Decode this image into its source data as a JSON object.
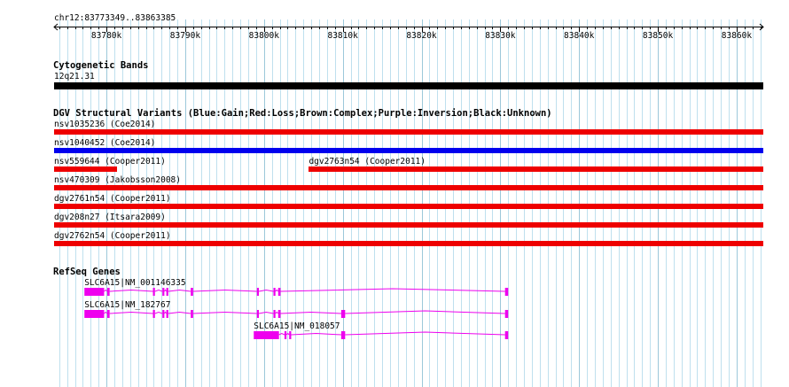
{
  "location": {
    "label": "chr12:83773349..83863385",
    "start": 83773349,
    "end": 83863385
  },
  "ruler": {
    "ticks": [
      {
        "pos": 83780000,
        "label": "83780k"
      },
      {
        "pos": 83790000,
        "label": "83790k"
      },
      {
        "pos": 83800000,
        "label": "83800k"
      },
      {
        "pos": 83810000,
        "label": "83810k"
      },
      {
        "pos": 83820000,
        "label": "83820k"
      },
      {
        "pos": 83830000,
        "label": "83830k"
      },
      {
        "pos": 83840000,
        "label": "83840k"
      },
      {
        "pos": 83850000,
        "label": "83850k"
      },
      {
        "pos": 83860000,
        "label": "83860k"
      }
    ],
    "minor_step": 1000
  },
  "colors": {
    "grid_minor": "#bfe0ee",
    "grid_major": "#9cc8da",
    "gain": "#0000ee",
    "loss": "#ee0000",
    "cytoband": "#000000",
    "gene": "#ee00ee"
  },
  "tracks": {
    "cytoband": {
      "title": "Cytogenetic Bands",
      "band": {
        "name": "12q21.31",
        "start": 83773349,
        "end": 83863385
      }
    },
    "dgv": {
      "title": "DGV Structural Variants (Blue:Gain;Red:Loss;Brown:Complex;Purple:Inversion;Black:Unknown)",
      "variants": [
        {
          "label": "nsv1035236 (Coe2014)",
          "type": "loss",
          "start": 83773349,
          "end": 83863385
        },
        {
          "label": "nsv1040452 (Coe2014)",
          "type": "gain",
          "start": 83773349,
          "end": 83863385
        },
        {
          "label": "nsv559644 (Cooper2011)",
          "type": "loss",
          "start": 83773349,
          "end": 83781300
        },
        {
          "label": "dgv2763n54 (Cooper2011)",
          "type": "loss",
          "start": 83805700,
          "end": 83863385
        },
        {
          "label": "nsv470309 (Jakobsson2008)",
          "type": "loss",
          "start": 83773349,
          "end": 83863385
        },
        {
          "label": "dgv2761n54 (Cooper2011)",
          "type": "loss",
          "start": 83773349,
          "end": 83863385
        },
        {
          "label": "dgv208n27 (Itsara2009)",
          "type": "loss",
          "start": 83773349,
          "end": 83863385
        },
        {
          "label": "dgv2762n54 (Cooper2011)",
          "type": "loss",
          "start": 83773349,
          "end": 83863385
        }
      ]
    },
    "refseq": {
      "title": "RefSeq Genes",
      "transcripts": [
        {
          "label": "SLC6A15|NM_001146335",
          "start": 83777200,
          "end": 83831000,
          "exons": [
            {
              "start": 83777200,
              "end": 83779700
            },
            {
              "start": 83780100,
              "end": 83780400
            },
            {
              "start": 83785900,
              "end": 83786150
            },
            {
              "start": 83787100,
              "end": 83787350
            },
            {
              "start": 83787600,
              "end": 83787850
            },
            {
              "start": 83790700,
              "end": 83791000
            },
            {
              "start": 83799100,
              "end": 83799350
            },
            {
              "start": 83801200,
              "end": 83801450
            },
            {
              "start": 83801800,
              "end": 83802100
            },
            {
              "start": 83830600,
              "end": 83831000
            }
          ]
        },
        {
          "label": "SLC6A15|NM_182767",
          "start": 83777200,
          "end": 83831000,
          "exons": [
            {
              "start": 83777200,
              "end": 83779700
            },
            {
              "start": 83780100,
              "end": 83780400
            },
            {
              "start": 83785900,
              "end": 83786150
            },
            {
              "start": 83787100,
              "end": 83787350
            },
            {
              "start": 83787600,
              "end": 83787850
            },
            {
              "start": 83790700,
              "end": 83791000
            },
            {
              "start": 83799100,
              "end": 83799350
            },
            {
              "start": 83801200,
              "end": 83801450
            },
            {
              "start": 83801800,
              "end": 83802100
            },
            {
              "start": 83809800,
              "end": 83810300
            },
            {
              "start": 83830600,
              "end": 83831000
            }
          ]
        },
        {
          "label": "SLC6A15|NM_018057",
          "start": 83798700,
          "end": 83831000,
          "exons": [
            {
              "start": 83798700,
              "end": 83801900
            },
            {
              "start": 83802600,
              "end": 83802850
            },
            {
              "start": 83803200,
              "end": 83803450
            },
            {
              "start": 83809800,
              "end": 83810300
            },
            {
              "start": 83830600,
              "end": 83831000
            }
          ]
        }
      ]
    }
  }
}
